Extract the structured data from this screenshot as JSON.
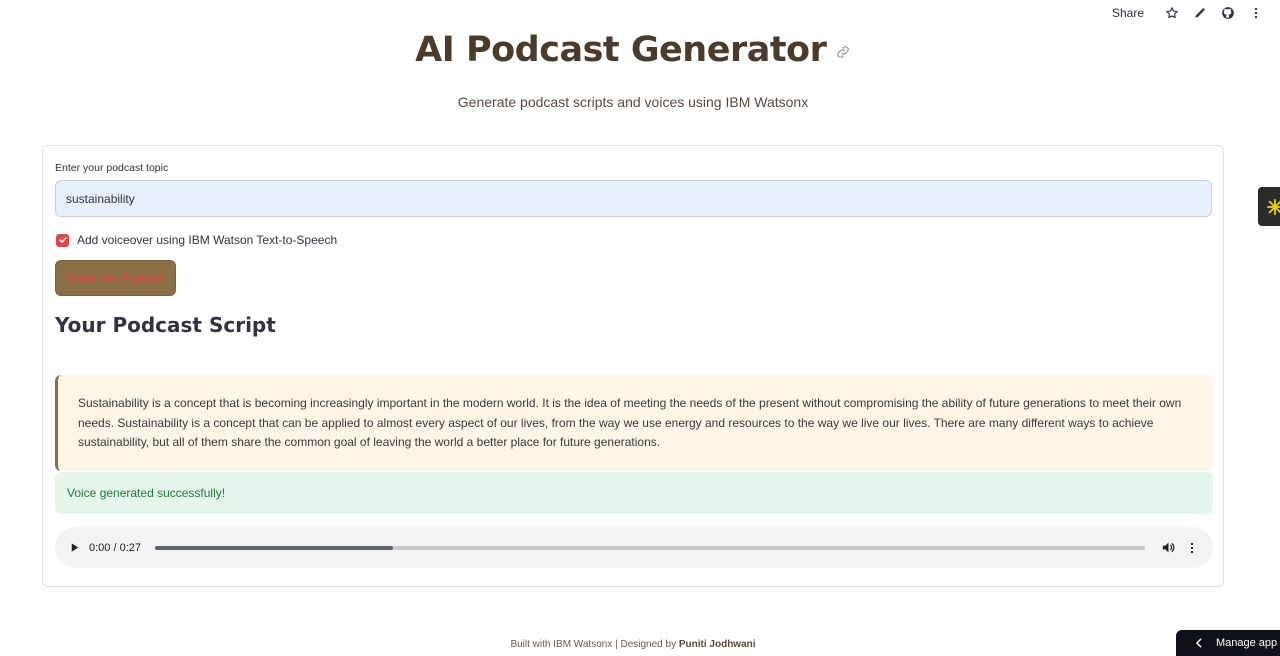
{
  "toolbar": {
    "share_label": "Share",
    "icons": [
      "star-icon",
      "pencil-icon",
      "github-icon",
      "kebab-menu-icon"
    ]
  },
  "header": {
    "title": "AI Podcast Generator",
    "subtitle": "Generate podcast scripts and voices using IBM Watsonx"
  },
  "form": {
    "topic_label": "Enter your podcast topic",
    "topic_value": "sustainability",
    "voiceover_checked": true,
    "voiceover_label": "Add voiceover using IBM Watson Text-to-Speech",
    "generate_button_label": "Generate Podcast"
  },
  "result": {
    "section_title": "Your Podcast Script",
    "script_text": "Sustainability is a concept that is becoming increasingly important in the modern world. It is the idea of meeting the needs of the present without compromising the ability of future generations to meet their own needs. Sustainability is a concept that can be applied to almost every aspect of our lives, from the way we use energy and resources to the way we live our lives. There are many different ways to achieve sustainability, but all of them share the common goal of leaving the world a better place for future generations.",
    "success_message": "Voice generated successfully!"
  },
  "audio": {
    "time_display": "0:00 / 0:27",
    "buffered_fraction": 0.24
  },
  "footer": {
    "built_with": "Built with IBM Watsonx | Designed by ",
    "author": "Puniti Jodhwani"
  },
  "manage_app_label": "Manage app",
  "colors": {
    "accent_brown": "#8b6f47",
    "title_brown": "#4a3b2c",
    "checkbox_red": "#e0464d",
    "input_bg": "#e8f0fe",
    "script_bg": "#fdf5e6",
    "success_bg": "#e5f6eb",
    "success_text": "#1f7a3a"
  }
}
